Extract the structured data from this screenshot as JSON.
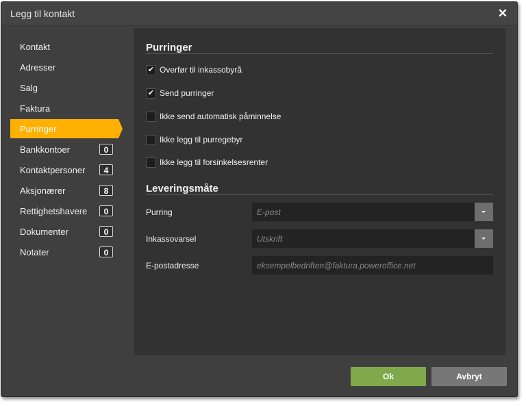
{
  "dialog": {
    "title": "Legg til kontakt"
  },
  "nav": {
    "items": [
      {
        "label": "Kontakt"
      },
      {
        "label": "Adresser"
      },
      {
        "label": "Salg"
      },
      {
        "label": "Faktura"
      },
      {
        "label": "Purringer",
        "active": true
      },
      {
        "label": "Bankkontoer",
        "count": "0"
      },
      {
        "label": "Kontaktpersoner",
        "count": "4"
      },
      {
        "label": "Aksjonærer",
        "count": "8"
      },
      {
        "label": "Rettighetshavere",
        "count": "0"
      },
      {
        "label": "Dokumenter",
        "count": "0"
      },
      {
        "label": "Notater",
        "count": "0"
      }
    ]
  },
  "purringer": {
    "title": "Purringer",
    "options": [
      {
        "label": "Overfør til inkassobyrå",
        "checked": true
      },
      {
        "label": "Send purringer",
        "checked": true
      },
      {
        "label": "Ikke send automatisk påminnelse",
        "checked": false
      },
      {
        "label": "Ikke legg til purregebyr",
        "checked": false
      },
      {
        "label": "Ikke legg til forsinkelsesrenter",
        "checked": false
      }
    ]
  },
  "levering": {
    "title": "Leveringsmåte",
    "purring": {
      "label": "Purring",
      "placeholder": "E-post"
    },
    "inkassovarsel": {
      "label": "Inkassovarsel",
      "placeholder": "Utskrift"
    },
    "epost": {
      "label": "E-postadresse",
      "placeholder": "eksempelbedriften@faktura.poweroffice.net"
    }
  },
  "footer": {
    "ok_label": "Ok",
    "cancel_label": "Avbryt"
  },
  "colors": {
    "accent": "#ffb000",
    "ok": "#7fa94a",
    "cancel": "#777777"
  },
  "icons": {
    "close": "close-icon",
    "check": "check-icon",
    "dropdown": "chevron-down-icon"
  }
}
